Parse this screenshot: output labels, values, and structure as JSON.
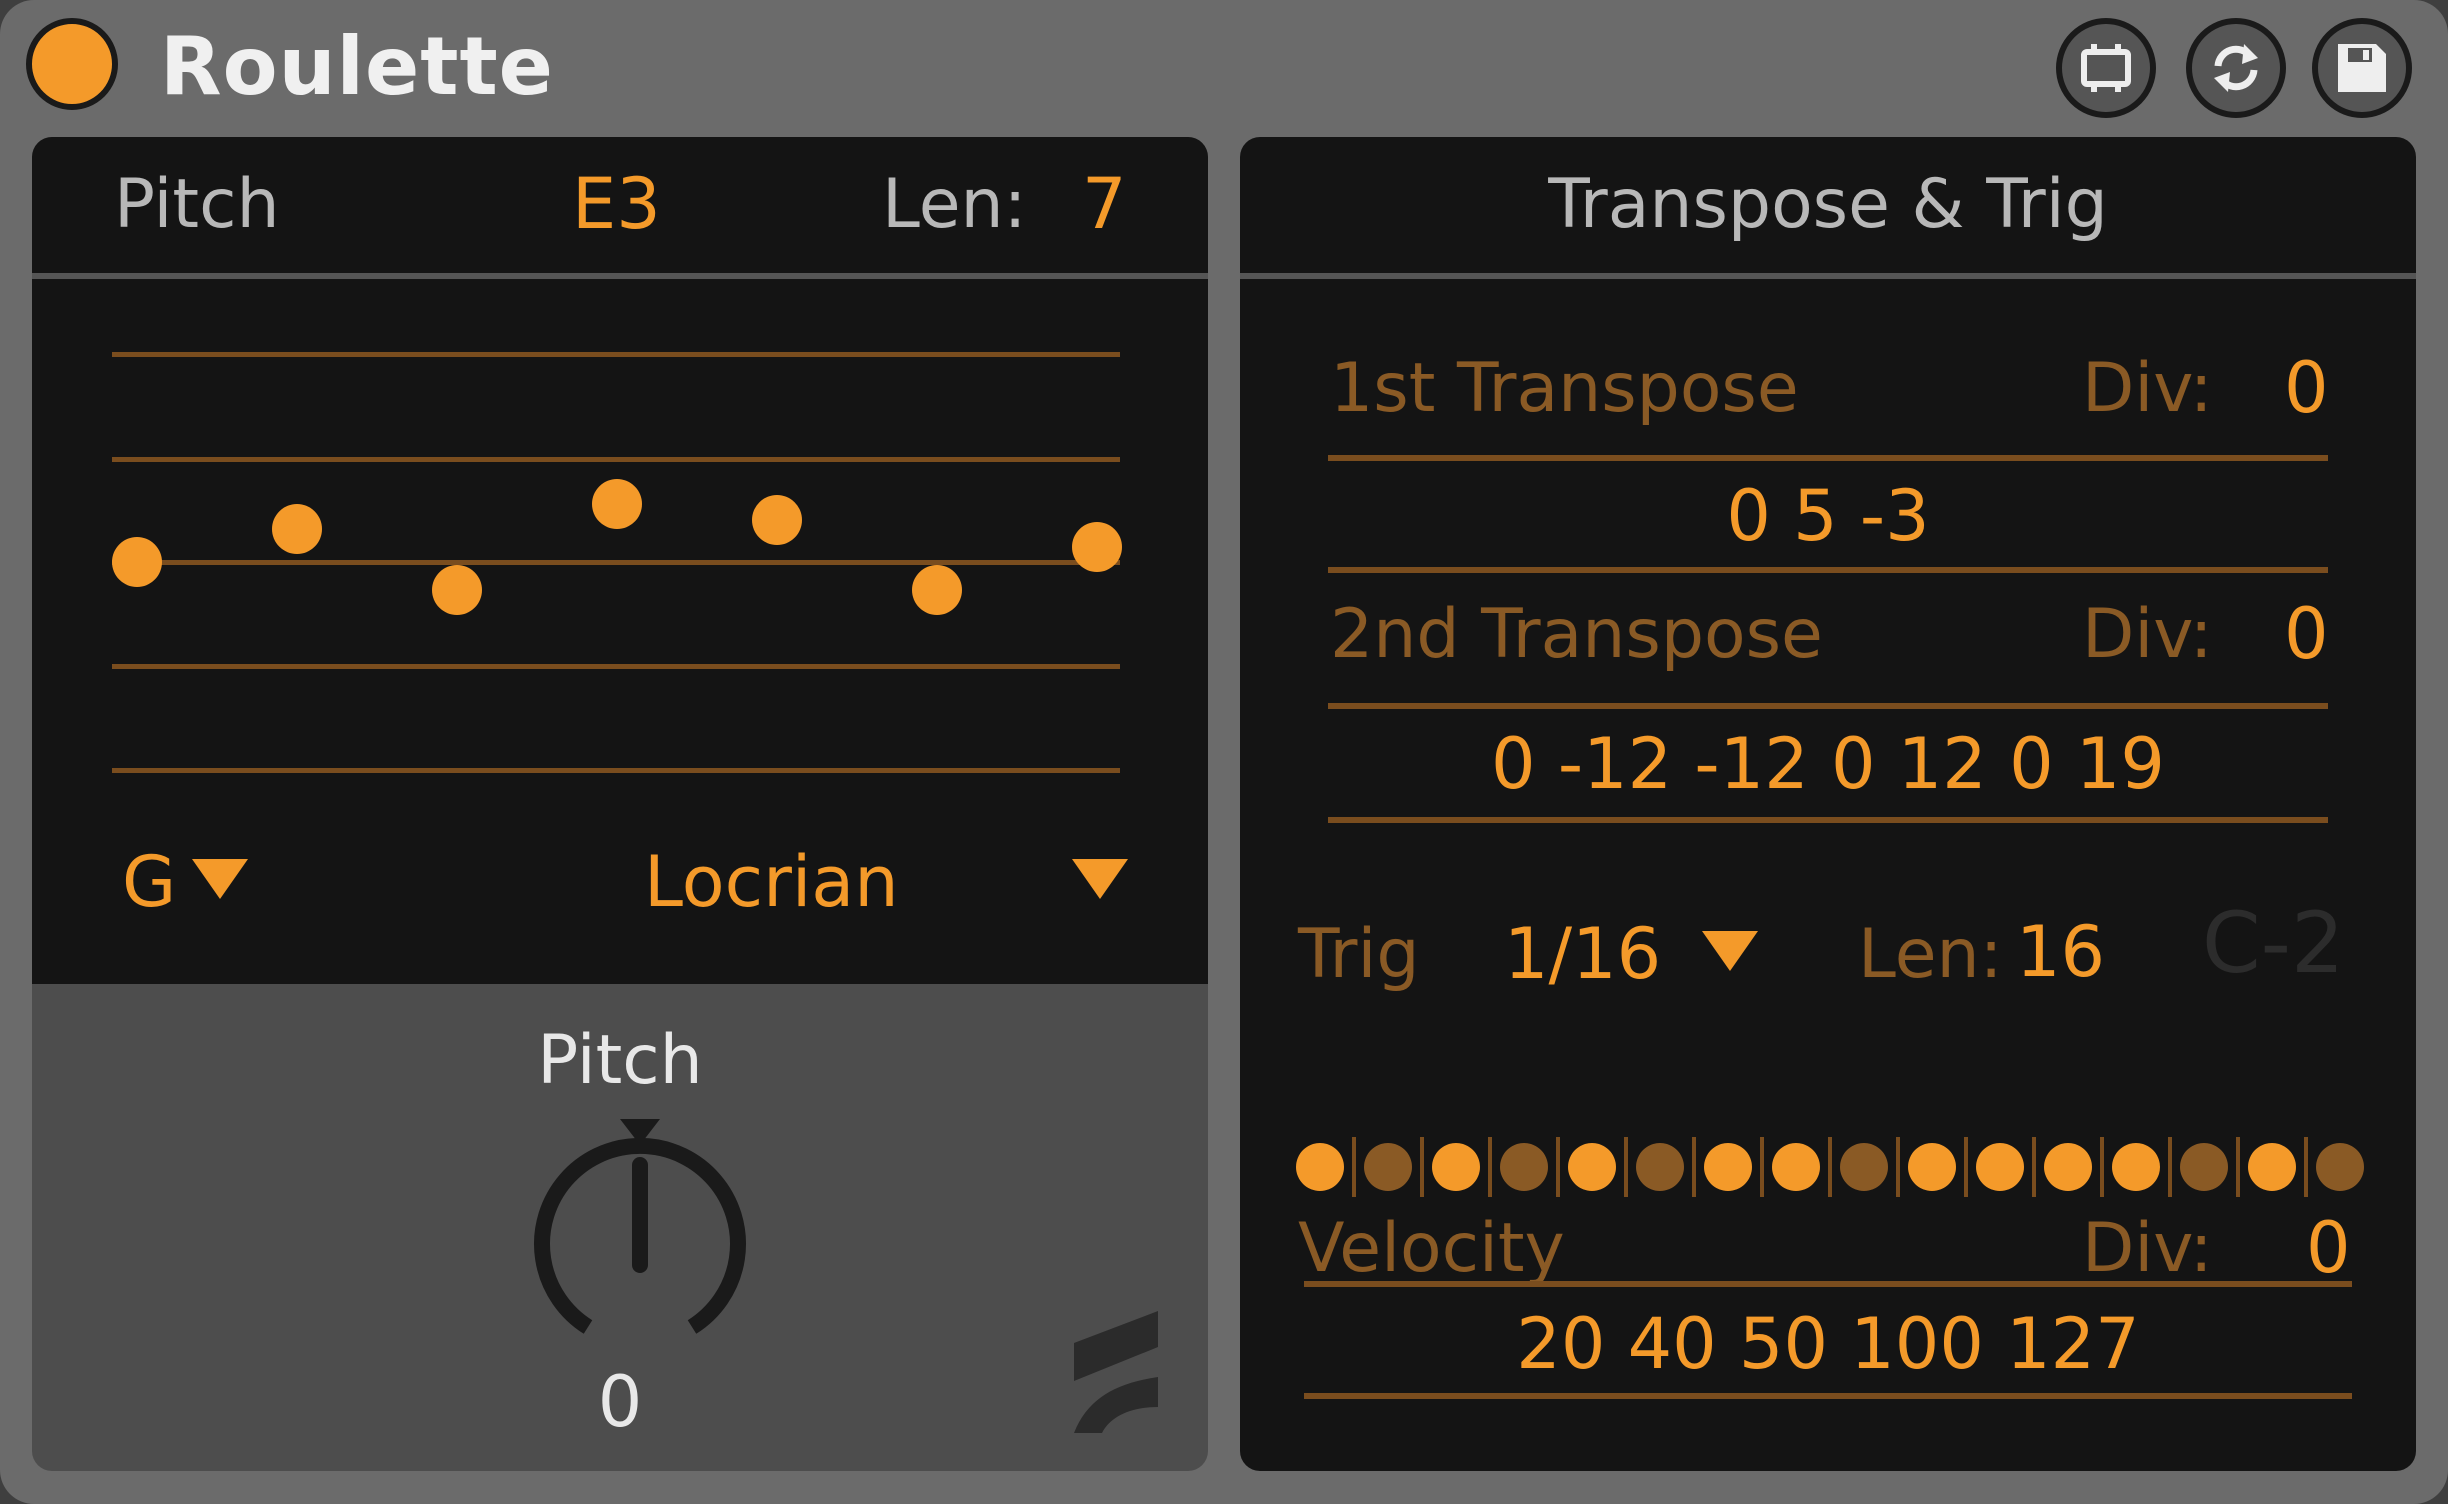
{
  "app": {
    "title": "Roulette"
  },
  "colors": {
    "accent": "#f49a2a",
    "dim": "#8a5a25",
    "panel": "#141414",
    "chrome": "#6b6b6b"
  },
  "toolbar": {
    "icons": [
      "clip-icon",
      "refresh-icon",
      "save-icon"
    ]
  },
  "pitch_panel": {
    "label": "Pitch",
    "note": "E3",
    "len_label": "Len:",
    "len_value": "7",
    "root": "G",
    "scale": "Locrian",
    "knob_label": "Pitch",
    "knob_value": "0",
    "knob_level": 0.0
  },
  "transpose_panel": {
    "title": "Transpose & Trig",
    "first": {
      "label": "1st Transpose",
      "div_label": "Div:",
      "div_value": "0",
      "sequence": "0 5 -3"
    },
    "second": {
      "label": "2nd Transpose",
      "div_label": "Div:",
      "div_value": "0",
      "sequence": "0 -12 -12 0 12 0 19"
    },
    "trig": {
      "label": "Trig",
      "rate": "1/16",
      "len_label": "Len:",
      "len_value": "16",
      "note": "C-2",
      "steps": [
        1,
        0,
        1,
        0,
        1,
        0,
        1,
        1,
        0,
        1,
        1,
        1,
        1,
        0,
        1,
        0
      ]
    },
    "velocity": {
      "label": "Velocity",
      "div_label": "Div:",
      "div_value": "0",
      "sequence": "20 40 50 100 127"
    }
  }
}
